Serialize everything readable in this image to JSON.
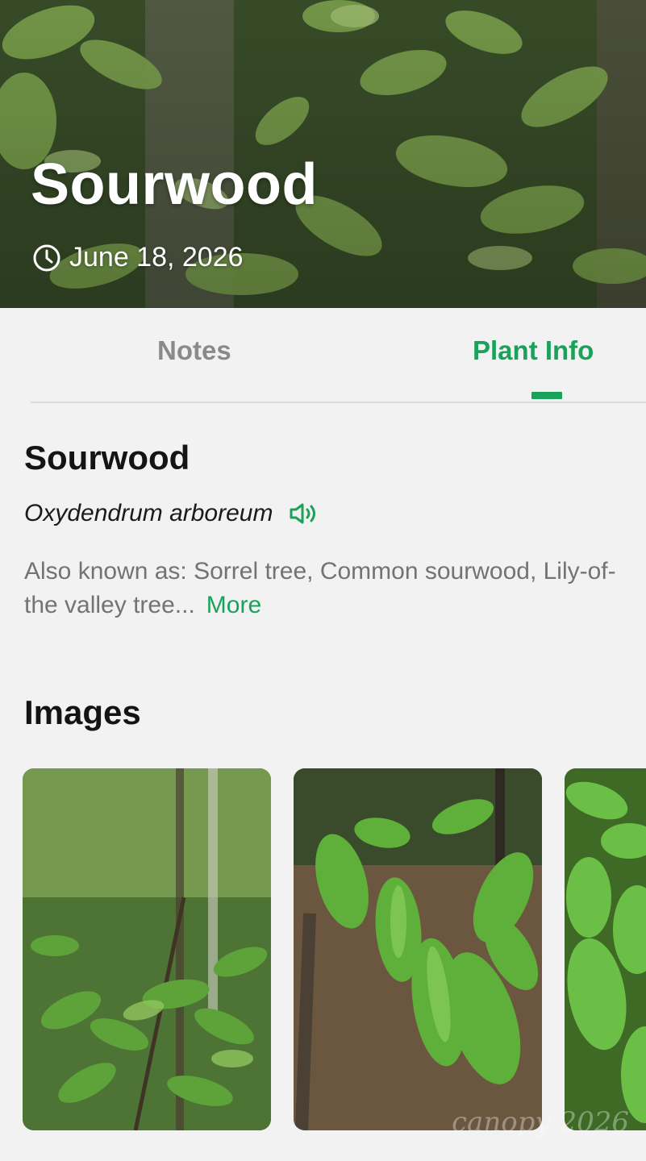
{
  "hero": {
    "title": "Sourwood",
    "date": "June 18, 2026"
  },
  "tabs": [
    {
      "label": "Notes",
      "active": false
    },
    {
      "label": "Plant Info",
      "active": true
    }
  ],
  "plant": {
    "common_name": "Sourwood",
    "scientific_name": "Oxydendrum arboreum",
    "also_known_line1": "Also known as: Sorrel tree, Common sourwood, Lily-of-",
    "also_known_line2": "the valley tree...",
    "more_label": "More"
  },
  "images": {
    "title": "Images",
    "count_visible": 3
  },
  "colors": {
    "accent": "#1aa15a",
    "inactive_tab": "#8a8a8a",
    "background": "#f2f2f2"
  },
  "icons": {
    "date": "clock-icon",
    "pronounce": "speaker-icon"
  }
}
